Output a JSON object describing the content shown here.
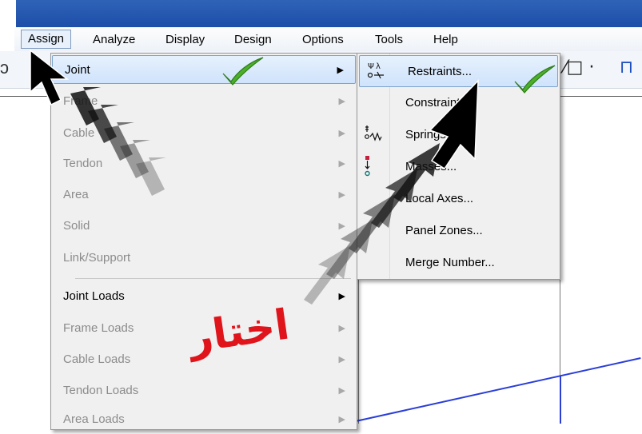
{
  "menubar": {
    "items": [
      {
        "label": "Assign",
        "active": true
      },
      {
        "label": "Analyze"
      },
      {
        "label": "Display"
      },
      {
        "label": "Design"
      },
      {
        "label": "Options"
      },
      {
        "label": "Tools"
      },
      {
        "label": "Help"
      }
    ]
  },
  "assign_menu": {
    "items": [
      {
        "label": "Joint",
        "state": "highlighted",
        "has_submenu": true
      },
      {
        "label": "Frame",
        "state": "disabled",
        "has_submenu": true
      },
      {
        "label": "Cable",
        "state": "disabled",
        "has_submenu": true
      },
      {
        "label": "Tendon",
        "state": "disabled",
        "has_submenu": true
      },
      {
        "label": "Area",
        "state": "disabled",
        "has_submenu": true
      },
      {
        "label": "Solid",
        "state": "disabled",
        "has_submenu": false
      },
      {
        "label": "Link/Support",
        "state": "disabled",
        "has_submenu": false
      },
      {
        "label": "Joint Loads",
        "state": "enabled",
        "has_submenu": true
      },
      {
        "label": "Frame Loads",
        "state": "disabled",
        "has_submenu": true
      },
      {
        "label": "Cable Loads",
        "state": "disabled",
        "has_submenu": true
      },
      {
        "label": "Tendon Loads",
        "state": "disabled",
        "has_submenu": true
      },
      {
        "label": "Area Loads",
        "state": "disabled",
        "has_submenu": true
      }
    ]
  },
  "joint_submenu": {
    "items": [
      {
        "label": "Restraints...",
        "icon": "restraint-icon",
        "state": "highlighted"
      },
      {
        "label": "Constraints...",
        "icon": "none"
      },
      {
        "label": "Springs...",
        "icon": "spring-icon"
      },
      {
        "label": "Masses...",
        "icon": "mass-icon"
      },
      {
        "label": "Local Axes...",
        "icon": "none"
      },
      {
        "label": "Panel Zones...",
        "icon": "none"
      },
      {
        "label": "Merge Number...",
        "icon": "none"
      }
    ]
  },
  "annotation": {
    "text": "اختار",
    "color": "#e0141b"
  },
  "colors": {
    "highlight": "#cfe3fb",
    "check": "#4caf2a",
    "model_line": "#2a3ed6"
  },
  "toolbar": {
    "glyph_left": "ɔ",
    "glyph_right": "⁄□ ·"
  }
}
